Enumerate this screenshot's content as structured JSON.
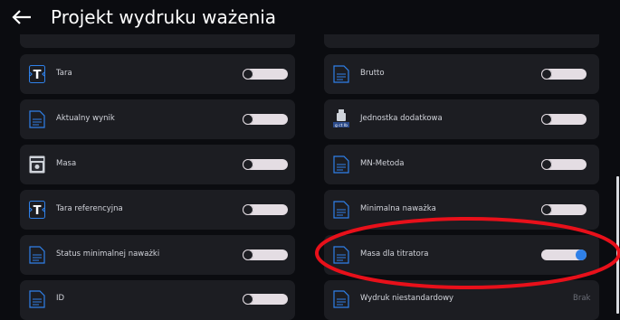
{
  "header": {
    "back_icon": "arrow-left-icon",
    "title": "Projekt wydruku ważenia"
  },
  "colors": {
    "background": "#0b0c10",
    "card": "#1c1d22",
    "text": "#d2d4db",
    "icon_blue": "#2f80e8",
    "toggle_track": "#e4dde3",
    "highlight": "#e8101a"
  },
  "left_items": [
    {
      "label": "Tara",
      "icon": "tare-icon",
      "toggle_on": false
    },
    {
      "label": "Aktualny wynik",
      "icon": "document-icon",
      "toggle_on": false
    },
    {
      "label": "Masa",
      "icon": "scale-icon",
      "toggle_on": false
    },
    {
      "label": "Tara referencyjna",
      "icon": "tare-icon",
      "toggle_on": false
    },
    {
      "label": "Status minimalnej naważki",
      "icon": "document-icon",
      "toggle_on": false
    },
    {
      "label": "ID",
      "icon": "document-icon",
      "toggle_on": false
    }
  ],
  "right_items": [
    {
      "label": "Brutto",
      "icon": "document-icon",
      "toggle_on": false
    },
    {
      "label": "Jednostka dodatkowa",
      "icon": "weight-unit-icon",
      "toggle_on": false
    },
    {
      "label": "MN-Metoda",
      "icon": "document-icon",
      "toggle_on": false
    },
    {
      "label": "Minimalna naważka",
      "icon": "document-icon",
      "toggle_on": false
    },
    {
      "label": "Masa dla titratora",
      "icon": "document-icon",
      "toggle_on": true
    },
    {
      "label": "Wydruk niestandardowy",
      "icon": "document-icon",
      "value": "Brak"
    }
  ]
}
